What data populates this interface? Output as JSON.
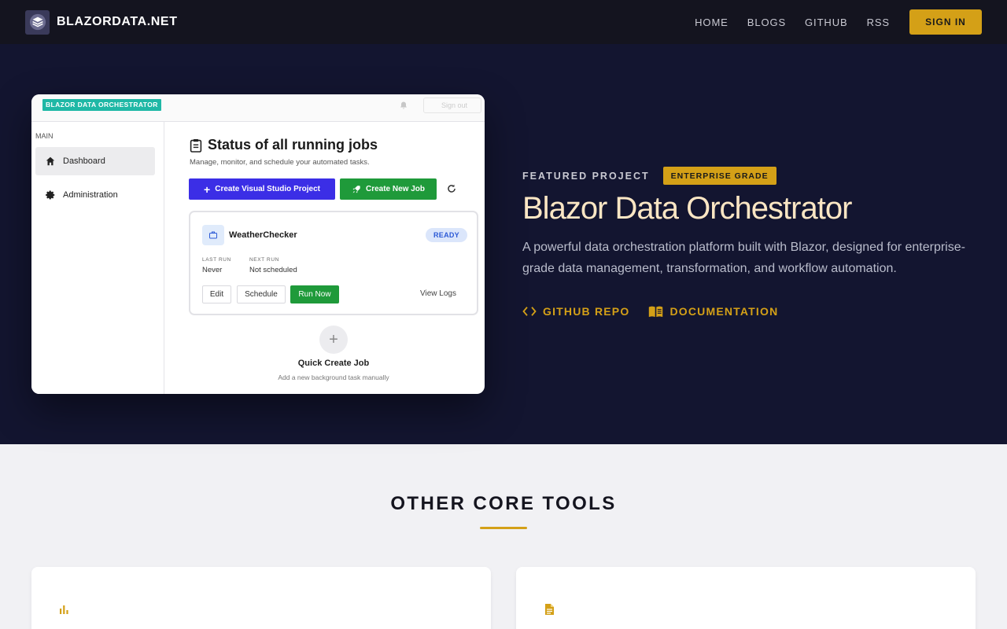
{
  "nav": {
    "brand": "BLAZORDATA.NET",
    "links": [
      "HOME",
      "BLOGS",
      "GITHUB",
      "RSS"
    ],
    "signin": "SIGN IN"
  },
  "preview": {
    "brand": "BLAZOR DATA ORCHESTRATOR",
    "signout": "Sign out",
    "sidebar_section": "MAIN",
    "sidebar_items": [
      "Dashboard",
      "Administration"
    ],
    "title": "Status of all running jobs",
    "subtitle": "Manage, monitor, and schedule your automated tasks.",
    "btn_create_vs": "Create Visual Studio Project",
    "btn_create_job": "Create New Job",
    "job": {
      "name": "WeatherChecker",
      "status": "READY",
      "last_run_label": "LAST RUN",
      "last_run": "Never",
      "next_run_label": "NEXT RUN",
      "next_run": "Not scheduled",
      "edit": "Edit",
      "schedule": "Schedule",
      "run_now": "Run Now",
      "view_logs": "View Logs"
    },
    "quick_title": "Quick Create Job",
    "quick_sub": "Add a new background task manually"
  },
  "hero": {
    "featured_label": "FEATURED PROJECT",
    "badge": "ENTERPRISE GRADE",
    "title": "Blazor Data Orchestrator",
    "description": "A powerful data orchestration platform built with Blazor, designed for enterprise-grade data management, transformation, and workflow automation.",
    "link_github": "GITHUB REPO",
    "link_docs": "DOCUMENTATION"
  },
  "tools": {
    "title": "OTHER CORE TOOLS"
  },
  "colors": {
    "accent": "#d4a017",
    "hero_bg": "#131530",
    "nav_bg": "#14141f"
  }
}
